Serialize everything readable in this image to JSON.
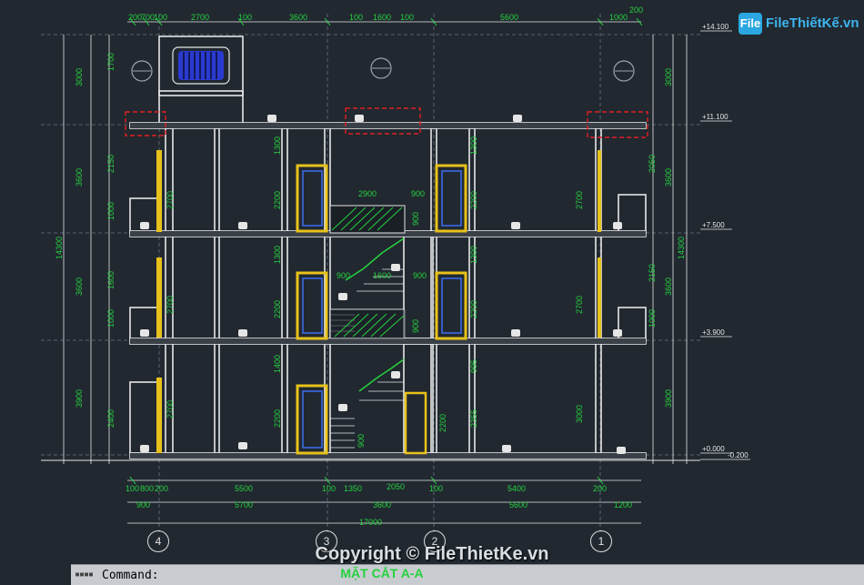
{
  "logo": {
    "box_text": "File",
    "text": "FileThiếtKế.vn"
  },
  "watermark": "Copyright © FileThietKe.vn",
  "drawing_title": "MẶT CẮT A-A",
  "command": {
    "label": "Command:"
  },
  "axes": [
    "4",
    "3",
    "2",
    "1"
  ],
  "levels": [
    "+14.100",
    "+11.100",
    "+7.500",
    "+3.900",
    "+0.000",
    "-0.200"
  ],
  "top_dims": [
    "200",
    "700",
    "100",
    "2700",
    "100",
    "3600",
    "100",
    "1600",
    "100",
    "5600",
    "1000",
    "200"
  ],
  "bottom_dims_row1": [
    "100",
    "800",
    "200",
    "5500",
    "100",
    "1350",
    "2050",
    "100",
    "5400",
    "200"
  ],
  "bottom_dims_row2": [
    "900",
    "5700",
    "3600",
    "5600",
    "1200"
  ],
  "bottom_total": "17000",
  "left_dims": [
    "3000",
    "3600",
    "14300",
    "3600",
    "3900"
  ],
  "right_dims": [
    "3000",
    "3600",
    "14300",
    "3600",
    "3900"
  ],
  "stair_labels": [
    "2900",
    "900",
    "900",
    "1600",
    "900",
    "900"
  ],
  "colors": {
    "background": "#212830",
    "green": "#26d13f",
    "white": "#e6e6e6",
    "red": "#e02020",
    "yellow": "#e8c21a",
    "blue": "#3c6ef0",
    "cyan": "#3fc7d8"
  }
}
